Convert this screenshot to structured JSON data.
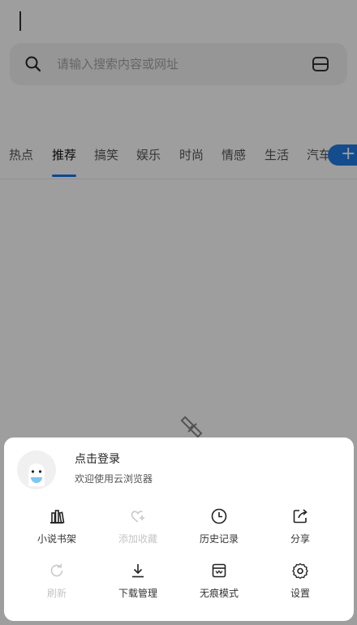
{
  "search": {
    "placeholder": "请输入搜索内容或网址"
  },
  "tabs": [
    {
      "label": "热点"
    },
    {
      "label": "推荐"
    },
    {
      "label": "搞笑"
    },
    {
      "label": "娱乐"
    },
    {
      "label": "时尚"
    },
    {
      "label": "情感"
    },
    {
      "label": "生活"
    },
    {
      "label": "汽车"
    }
  ],
  "tab_add_label": "+",
  "menu": {
    "user": {
      "title": "点击登录",
      "subtitle": "欢迎使用云浏览器"
    },
    "items": [
      {
        "label": "小说书架",
        "icon": "bookshelf-icon",
        "enabled": true
      },
      {
        "label": "添加收藏",
        "icon": "heart-plus-icon",
        "enabled": false
      },
      {
        "label": "历史记录",
        "icon": "clock-icon",
        "enabled": true
      },
      {
        "label": "分享",
        "icon": "share-icon",
        "enabled": true
      },
      {
        "label": "刷新",
        "icon": "refresh-icon",
        "enabled": false
      },
      {
        "label": "下载管理",
        "icon": "download-icon",
        "enabled": true
      },
      {
        "label": "无痕模式",
        "icon": "incognito-icon",
        "enabled": true
      },
      {
        "label": "设置",
        "icon": "gear-icon",
        "enabled": true
      }
    ]
  },
  "colors": {
    "accent": "#1677e8",
    "overlay": "rgba(0,0,0,0.38)",
    "disabled": "#c5c5c5"
  }
}
